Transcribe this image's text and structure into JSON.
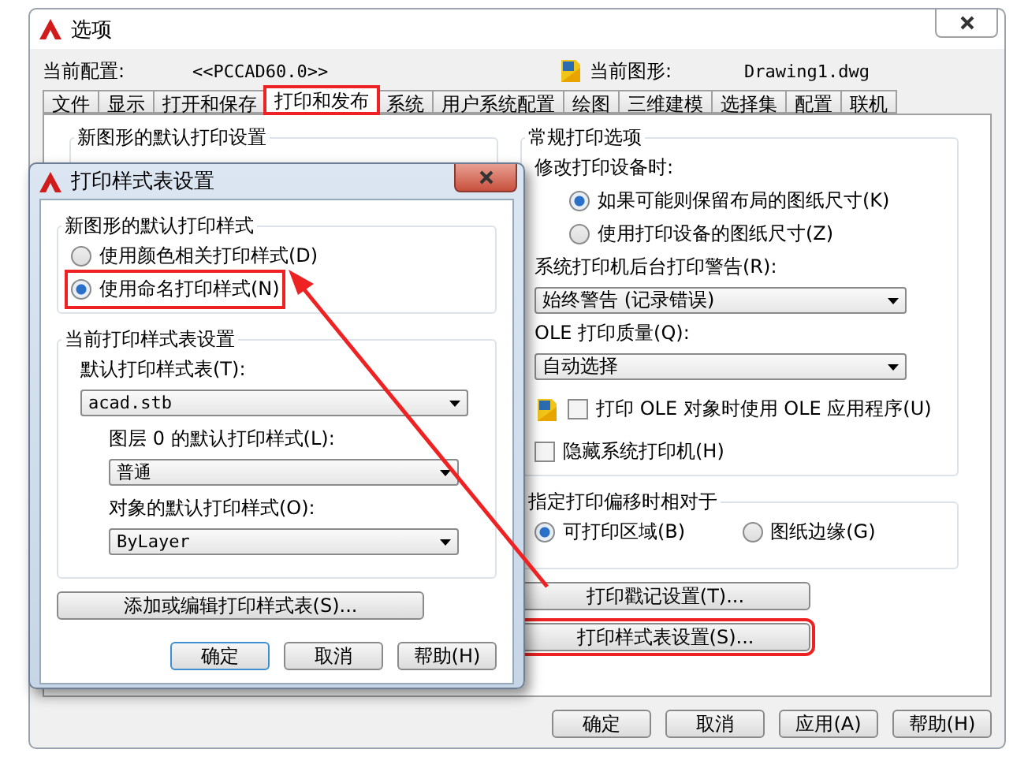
{
  "window": {
    "title": "选项"
  },
  "header": {
    "profile_label": "当前配置:",
    "profile_value": "<<PCCAD60.0>>",
    "drawing_label": "当前图形:",
    "drawing_value": "Drawing1.dwg"
  },
  "tabs": [
    {
      "label": "文件",
      "selected": false,
      "highlighted": false
    },
    {
      "label": "显示",
      "selected": false,
      "highlighted": false
    },
    {
      "label": "打开和保存",
      "selected": false,
      "highlighted": false
    },
    {
      "label": "打印和发布",
      "selected": true,
      "highlighted": true
    },
    {
      "label": "系统",
      "selected": false,
      "highlighted": false
    },
    {
      "label": "用户系统配置",
      "selected": false,
      "highlighted": false
    },
    {
      "label": "绘图",
      "selected": false,
      "highlighted": false
    },
    {
      "label": "三维建模",
      "selected": false,
      "highlighted": false
    },
    {
      "label": "选择集",
      "selected": false,
      "highlighted": false
    },
    {
      "label": "配置",
      "selected": false,
      "highlighted": false
    },
    {
      "label": "联机",
      "selected": false,
      "highlighted": false
    }
  ],
  "left_group": {
    "title": "新图形的默认打印设置"
  },
  "general_group": {
    "title": "常规打印选项",
    "change_label": "修改打印设备时:",
    "paper_options": [
      {
        "label": "如果可能则保留布局的图纸尺寸(K)",
        "selected": true
      },
      {
        "label": "使用打印设备的图纸尺寸(Z)",
        "selected": false
      }
    ],
    "spool_label": "系统打印机后台打印警告(R):",
    "spool_value": "始终警告 (记录错误)",
    "ole_label": "OLE 打印质量(Q):",
    "ole_value": "自动选择",
    "checkboxes": [
      {
        "kind": "icon",
        "label": "打印 OLE 对象时使用 OLE 应用程序(U)",
        "checked": false
      },
      {
        "kind": "plain",
        "label": "隐藏系统打印机(H)",
        "checked": false
      }
    ]
  },
  "offset_group": {
    "title": "指定打印偏移时相对于",
    "options": [
      {
        "label": "可打印区域(B)",
        "selected": true
      },
      {
        "label": "图纸边缘(G)",
        "selected": false
      }
    ]
  },
  "side_buttons": [
    {
      "label": "打印戳记设置(T)...",
      "highlighted": false
    },
    {
      "label": "打印样式表设置(S)...",
      "highlighted": true
    }
  ],
  "buttons": [
    "确定",
    "取消",
    "应用(A)",
    "帮助(H)"
  ],
  "dialog": {
    "title": "打印样式表设置",
    "style_group": {
      "title": "新图形的默认打印样式",
      "options": [
        {
          "label": "使用颜色相关打印样式(D)",
          "selected": false,
          "highlighted": false
        },
        {
          "label": "使用命名打印样式(N)",
          "selected": true,
          "highlighted": true
        }
      ]
    },
    "table_group": {
      "title": "当前打印样式表设置",
      "fields": [
        {
          "label": "默认打印样式表(T):",
          "value": "acad.stb",
          "indented": false
        },
        {
          "label": "图层 0 的默认打印样式(L):",
          "value": "普通",
          "indented": true
        },
        {
          "label": "对象的默认打印样式(O):",
          "value": "ByLayer",
          "indented": true
        }
      ]
    },
    "edit_button": "添加或编辑打印样式表(S)...",
    "buttons": [
      {
        "label": "确定",
        "default": true
      },
      {
        "label": "取消",
        "default": false
      },
      {
        "label": "帮助(H)",
        "default": false
      }
    ]
  }
}
